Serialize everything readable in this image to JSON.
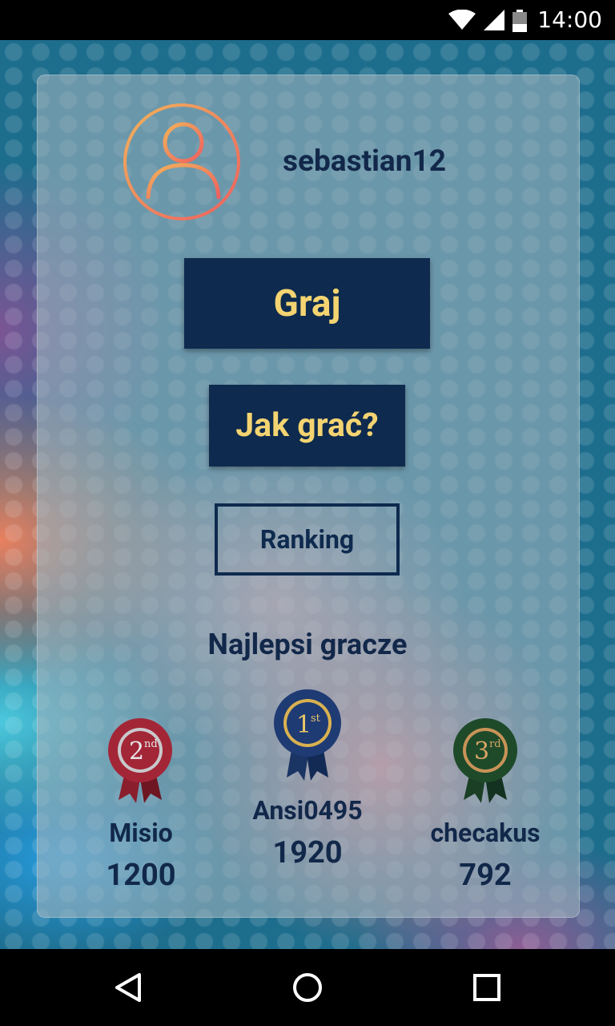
{
  "status_bar": {
    "time": "14:00",
    "icons": [
      "wifi-icon",
      "signal-icon",
      "battery-icon"
    ]
  },
  "profile": {
    "username": "sebastian12",
    "avatar_icon": "user-icon"
  },
  "buttons": {
    "play_label": "Graj",
    "how_to_label": "Jak grać?",
    "ranking_label": "Ranking"
  },
  "top_players": {
    "title": "Najlepsi gracze",
    "first": {
      "place_badge": "1st",
      "name": "Ansi0495",
      "score": "1920"
    },
    "second": {
      "place_badge": "2nd",
      "name": "Misio",
      "score": "1200"
    },
    "third": {
      "place_badge": "3rd",
      "name": "checakus",
      "score": "792"
    }
  },
  "nav_bar": {
    "icons": [
      "back-icon",
      "home-icon",
      "recents-icon"
    ]
  },
  "colors": {
    "button_bg": "#0e2a4e",
    "button_text": "#f4d471",
    "text_dark": "#12284a",
    "medal_gold_blue": "#1f3b74",
    "medal_silver_red": "#a32637",
    "medal_bronze_green": "#1e4a2a"
  }
}
